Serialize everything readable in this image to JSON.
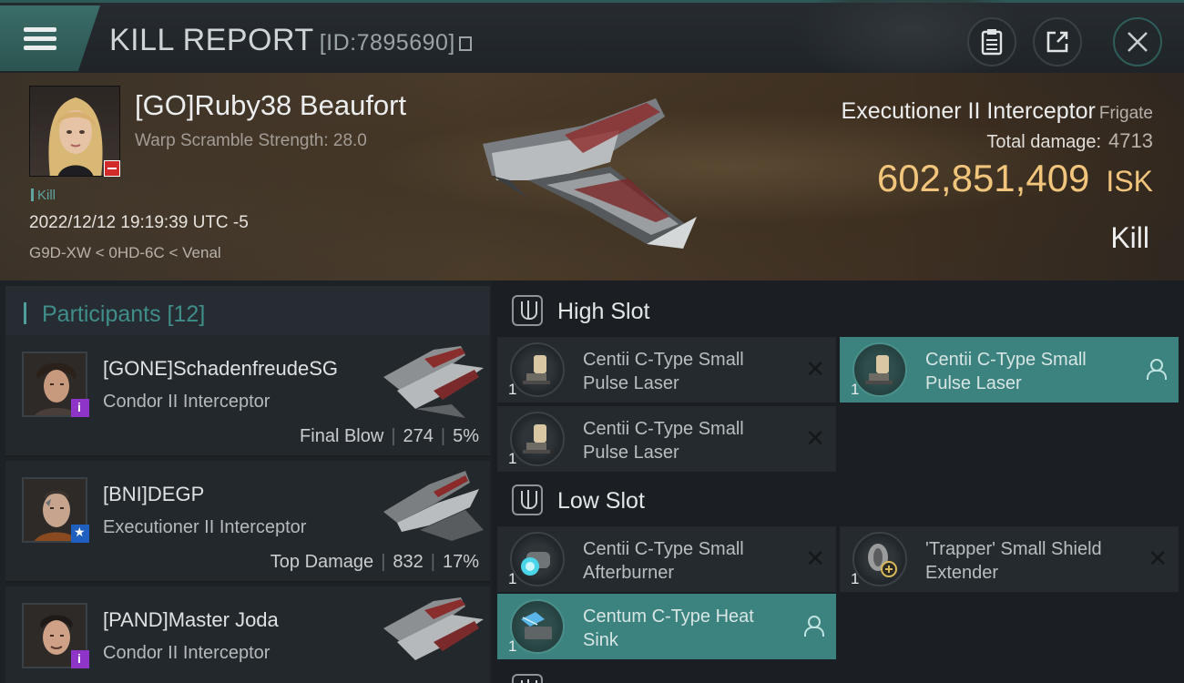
{
  "header": {
    "title": "KILL REPORT",
    "report_id": "[ID:7895690]"
  },
  "victim": {
    "name": "[GO]Ruby38 Beaufort",
    "warp_scramble": "Warp Scramble Strength: 28.0",
    "tag": "Kill",
    "datetime": "2022/12/12 19:19:39 UTC -5",
    "location": "G9D-XW < 0HD-6C < Venal"
  },
  "ship": {
    "name": "Executioner II Interceptor",
    "class": "Frigate",
    "total_damage_label": "Total damage:",
    "total_damage": "4713",
    "value": "602,851,409",
    "unit": "ISK",
    "result": "Kill"
  },
  "participants": {
    "label": "Participants [12]",
    "rows": [
      {
        "name": "[GONE]SchadenfreudeSG",
        "ship": "Condor II Interceptor",
        "role": "Final Blow",
        "damage": "274",
        "percent": "5%",
        "badge": "purple"
      },
      {
        "name": "[BNI]DEGP",
        "ship": "Executioner II Interceptor",
        "role": "Top Damage",
        "damage": "832",
        "percent": "17%",
        "badge": "blue"
      },
      {
        "name": "[PAND]Master Joda",
        "ship": "Condor II Interceptor",
        "role": "",
        "damage": "",
        "percent": "",
        "badge": "purple"
      }
    ]
  },
  "fitting": {
    "high_slot": {
      "label": "High Slot",
      "modules": [
        {
          "name": "Centii C-Type Small Pulse Laser",
          "qty": "1",
          "state": "destroyed",
          "icon": "laser-turret-icon"
        },
        {
          "name": "Centii C-Type Small Pulse Laser",
          "qty": "1",
          "state": "dropped",
          "icon": "laser-turret-icon"
        },
        {
          "name": "Centii C-Type Small Pulse Laser",
          "qty": "1",
          "state": "destroyed",
          "icon": "laser-turret-icon"
        }
      ]
    },
    "low_slot": {
      "label": "Low Slot",
      "modules": [
        {
          "name": "Centii C-Type Small Afterburner",
          "qty": "1",
          "state": "destroyed",
          "icon": "afterburner-icon"
        },
        {
          "name": "'Trapper' Small Shield Extender",
          "qty": "1",
          "state": "destroyed",
          "icon": "shield-extender-icon"
        },
        {
          "name": "Centum C-Type Heat Sink",
          "qty": "1",
          "state": "dropped",
          "icon": "heat-sink-icon"
        }
      ]
    }
  },
  "colors": {
    "accent": "#3c827e",
    "isk": "#f1c57c",
    "badge_red": "#d02a2a"
  }
}
